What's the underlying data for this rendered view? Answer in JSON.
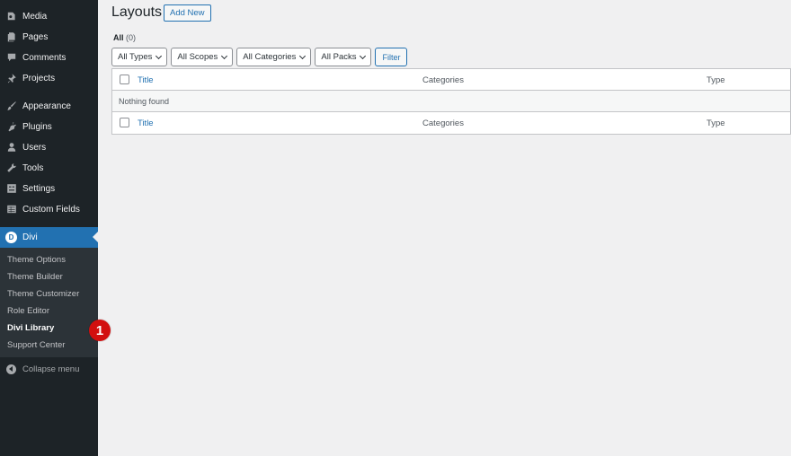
{
  "sidebar": {
    "items": [
      {
        "label": "Media",
        "icon": "media-icon"
      },
      {
        "label": "Pages",
        "icon": "pages-icon"
      },
      {
        "label": "Comments",
        "icon": "comments-icon"
      },
      {
        "label": "Projects",
        "icon": "pin-icon"
      },
      {
        "label": "Appearance",
        "icon": "brush-icon"
      },
      {
        "label": "Plugins",
        "icon": "plugin-icon"
      },
      {
        "label": "Users",
        "icon": "user-icon"
      },
      {
        "label": "Tools",
        "icon": "wrench-icon"
      },
      {
        "label": "Settings",
        "icon": "settings-icon"
      },
      {
        "label": "Custom Fields",
        "icon": "table-icon"
      }
    ],
    "active": {
      "label": "Divi",
      "badge": "D"
    },
    "submenu": [
      "Theme Options",
      "Theme Builder",
      "Theme Customizer",
      "Role Editor",
      "Divi Library",
      "Support Center"
    ],
    "collapse_label": "Collapse menu"
  },
  "step_badge": "1",
  "main": {
    "title": "Layouts",
    "add_new_label": "Add New",
    "views": {
      "all_label": "All",
      "all_count": "(0)"
    },
    "filters": [
      "All Types",
      "All Scopes",
      "All Categories",
      "All Packs"
    ],
    "filter_button": "Filter",
    "table": {
      "columns": {
        "title": "Title",
        "categories": "Categories",
        "type": "Type"
      },
      "empty_message": "Nothing found"
    }
  },
  "colors": {
    "sidebar_bg": "#1d2327",
    "accent": "#2271b1",
    "badge": "#d20f0f"
  }
}
